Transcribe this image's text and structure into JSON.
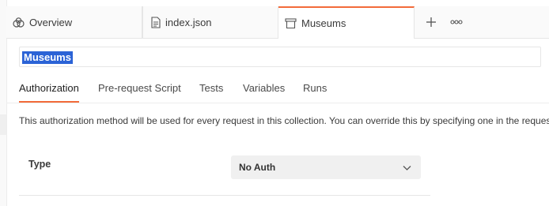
{
  "tabs": [
    {
      "label": "Overview",
      "icon": "overview-icon"
    },
    {
      "label": "index.json",
      "icon": "file-icon"
    },
    {
      "label": "Museums",
      "icon": "collection-icon"
    }
  ],
  "tab_actions": {
    "add": "+",
    "more": "ooo"
  },
  "collection_name": "Museums",
  "subtabs": [
    "Authorization",
    "Pre-request Script",
    "Tests",
    "Variables",
    "Runs"
  ],
  "description": "This authorization method will be used for every request in this collection. You can override this by specifying one in the request.",
  "auth": {
    "type_label": "Type",
    "type_value": "No Auth"
  },
  "colors": {
    "accent": "#f26b3a",
    "selection": "#2b63d6"
  }
}
